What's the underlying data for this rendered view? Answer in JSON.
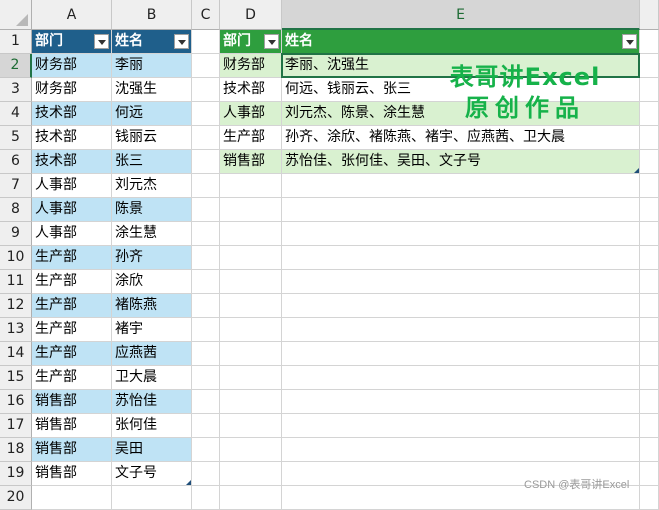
{
  "columns": [
    "A",
    "B",
    "C",
    "D",
    "E"
  ],
  "rows": [
    "1",
    "2",
    "3",
    "4",
    "5",
    "6",
    "7",
    "8",
    "9",
    "10",
    "11",
    "12",
    "13",
    "14",
    "15",
    "16",
    "17",
    "18",
    "19",
    "20"
  ],
  "selected_cell": {
    "col": "E",
    "row": "2"
  },
  "table1": {
    "headers": [
      "部门",
      "姓名"
    ],
    "rows": [
      [
        "财务部",
        "李丽"
      ],
      [
        "财务部",
        "沈强生"
      ],
      [
        "技术部",
        "何远"
      ],
      [
        "技术部",
        "钱丽云"
      ],
      [
        "技术部",
        "张三"
      ],
      [
        "人事部",
        "刘元杰"
      ],
      [
        "人事部",
        "陈景"
      ],
      [
        "人事部",
        "涂生慧"
      ],
      [
        "生产部",
        "孙齐"
      ],
      [
        "生产部",
        "涂欣"
      ],
      [
        "生产部",
        "褚陈燕"
      ],
      [
        "生产部",
        "褚宇"
      ],
      [
        "生产部",
        "应燕茜"
      ],
      [
        "生产部",
        "卫大晨"
      ],
      [
        "销售部",
        "苏怡佳"
      ],
      [
        "销售部",
        "张何佳"
      ],
      [
        "销售部",
        "吴田"
      ],
      [
        "销售部",
        "文子号"
      ]
    ]
  },
  "table2": {
    "headers": [
      "部门",
      "姓名"
    ],
    "rows": [
      [
        "财务部",
        "李丽、沈强生"
      ],
      [
        "技术部",
        "何远、钱丽云、张三"
      ],
      [
        "人事部",
        "刘元杰、陈景、涂生慧"
      ],
      [
        "生产部",
        "孙齐、涂欣、褚陈燕、褚宇、应燕茜、卫大晨"
      ],
      [
        "销售部",
        "苏怡佳、张何佳、吴田、文子号"
      ]
    ]
  },
  "watermark": {
    "line1": "表哥讲Excel",
    "line2": "原创作品"
  },
  "credit": "CSDN @表哥讲Excel",
  "colors": {
    "header_blue": "#1f5f8b",
    "band_blue": "#bfe3f5",
    "header_green": "#2e9e3e",
    "band_green": "#d9f1d0",
    "select": "#217346",
    "watermark": "#16b24a"
  }
}
